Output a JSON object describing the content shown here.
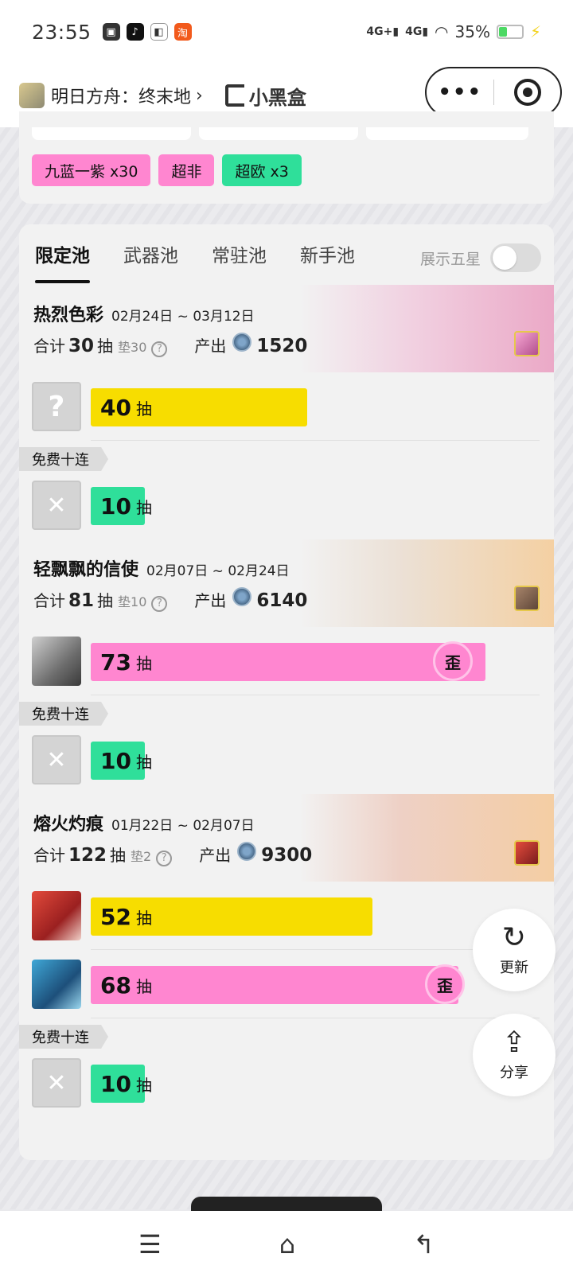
{
  "status_bar": {
    "time": "23:55",
    "signal1": "4G+",
    "signal2": "4G",
    "battery": "35%",
    "battery_level": 0.35
  },
  "title_bar": {
    "mini_program_title": "明日方舟：终末地",
    "brand_name": "小黑盒",
    "menu_icon": "more-dots-icon",
    "close_icon": "target-icon"
  },
  "top_card": {
    "tags": [
      {
        "label": "九蓝一紫 x30",
        "color": "#ff86d0"
      },
      {
        "label": "超非",
        "color": "#ff86d0"
      },
      {
        "label": "超欧 x3",
        "color": "#2fdf9a"
      }
    ]
  },
  "tabs": [
    "限定池",
    "武器池",
    "常驻池",
    "新手池"
  ],
  "active_tab": "限定池",
  "toggle": {
    "label": "展示五星",
    "on": false
  },
  "pools": [
    {
      "name": "热烈色彩",
      "dates": "02月24日 ~ 03月12日",
      "total_label": "合计",
      "total": "30",
      "pull_unit": "抽",
      "pad": "垫30",
      "output_label": "产出",
      "output": "1520",
      "pulls": [
        {
          "count": "40",
          "unit": "抽",
          "color": "#f7dd00",
          "avatar": "unknown",
          "off": false,
          "fill": 0.4
        }
      ],
      "free_label": "免费十连",
      "free_pull": {
        "count": "10",
        "unit": "抽",
        "fill": 0.1
      }
    },
    {
      "name": "轻飘飘的信使",
      "dates": "02月07日 ~ 02月24日",
      "total_label": "合计",
      "total": "81",
      "pull_unit": "抽",
      "pad": "垫10",
      "output_label": "产出",
      "output": "6140",
      "pulls": [
        {
          "count": "73",
          "unit": "抽",
          "color": "#ff86d0",
          "avatar": "character",
          "off": true,
          "off_label": "歪",
          "fill": 0.73
        }
      ],
      "free_label": "免费十连",
      "free_pull": {
        "count": "10",
        "unit": "抽",
        "fill": 0.1
      }
    },
    {
      "name": "熔火灼痕",
      "dates": "01月22日 ~ 02月07日",
      "total_label": "合计",
      "total": "122",
      "pull_unit": "抽",
      "pad": "垫2",
      "output_label": "产出",
      "output": "9300",
      "pulls": [
        {
          "count": "52",
          "unit": "抽",
          "color": "#f7dd00",
          "avatar": "character",
          "off": false,
          "fill": 0.52
        },
        {
          "count": "68",
          "unit": "抽",
          "color": "#ff86d0",
          "avatar": "character",
          "off": true,
          "off_label": "歪",
          "fill": 0.68
        }
      ],
      "free_label": "免费十连",
      "free_pull": {
        "count": "10",
        "unit": "抽",
        "fill": 0.1
      }
    }
  ],
  "fabs": {
    "refresh_label": "更新",
    "share_label": "分享"
  },
  "nav": [
    "menu-icon",
    "home-icon",
    "back-icon"
  ]
}
